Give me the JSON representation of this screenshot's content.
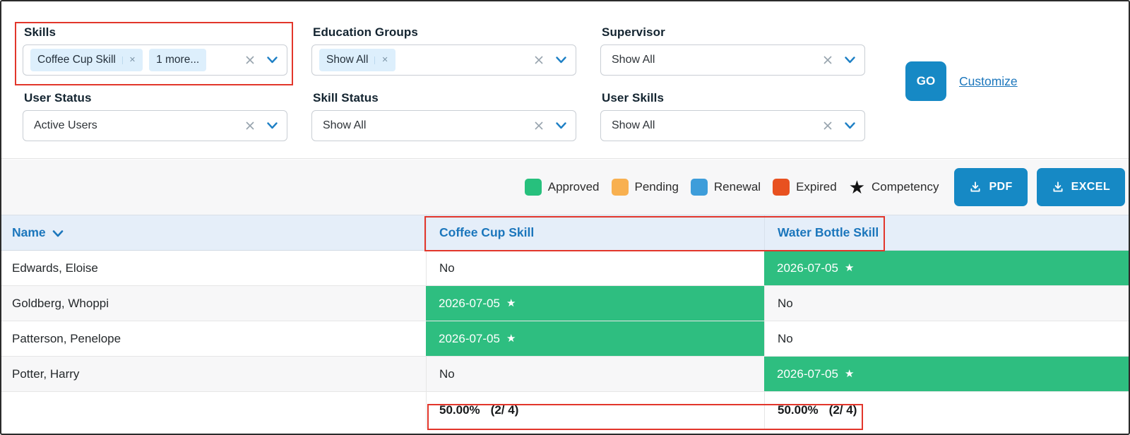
{
  "colors": {
    "accent": "#1689c5",
    "link_blue": "#1b76bc",
    "cell_approved": "#2ebe80",
    "highlight_red": "#e2362b",
    "header_bg": "#e5eef9"
  },
  "icons": {
    "star": "★"
  },
  "filters": {
    "skills": {
      "label": "Skills",
      "chips": [
        {
          "text": "Coffee Cup Skill",
          "removable": true
        },
        {
          "text": "1 more...",
          "removable": false
        }
      ]
    },
    "education_groups": {
      "label": "Education Groups",
      "chips": [
        {
          "text": "Show All",
          "removable": true
        }
      ]
    },
    "supervisor": {
      "label": "Supervisor",
      "value": "Show All"
    },
    "user_status": {
      "label": "User Status",
      "value": "Active Users"
    },
    "skill_status": {
      "label": "Skill Status",
      "value": "Show All"
    },
    "user_skills": {
      "label": "User Skills",
      "value": "Show All"
    },
    "go_label": "GO",
    "customize_label": "Customize"
  },
  "legend": [
    {
      "label": "Approved",
      "color": "#27c07d"
    },
    {
      "label": "Pending",
      "color": "#f8b050"
    },
    {
      "label": "Renewal",
      "color": "#3d9dda"
    },
    {
      "label": "Expired",
      "color": "#e85120"
    },
    {
      "label": "Competency"
    }
  ],
  "export_buttons": [
    {
      "label": "PDF"
    },
    {
      "label": "EXCEL"
    }
  ],
  "table": {
    "columns": [
      "Name",
      "Coffee Cup Skill",
      "Water Bottle Skill"
    ],
    "rows": [
      {
        "name": "Edwards, Eloise",
        "coffee": {
          "text": "No"
        },
        "water": {
          "text": "2026-07-05",
          "star": true
        }
      },
      {
        "name": "Goldberg, Whoppi",
        "coffee": {
          "text": "2026-07-05",
          "star": true
        },
        "water": {
          "text": "No"
        }
      },
      {
        "name": "Patterson, Penelope",
        "coffee": {
          "text": "2026-07-05",
          "star": true
        },
        "water": {
          "text": "No"
        }
      },
      {
        "name": "Potter, Harry",
        "coffee": {
          "text": "No"
        },
        "water": {
          "text": "2026-07-05",
          "star": true
        }
      }
    ],
    "footer": {
      "coffee_pct": "50.00%",
      "coffee_frac": "(2/ 4)",
      "water_pct": "50.00%",
      "water_frac": "(2/ 4)"
    }
  }
}
